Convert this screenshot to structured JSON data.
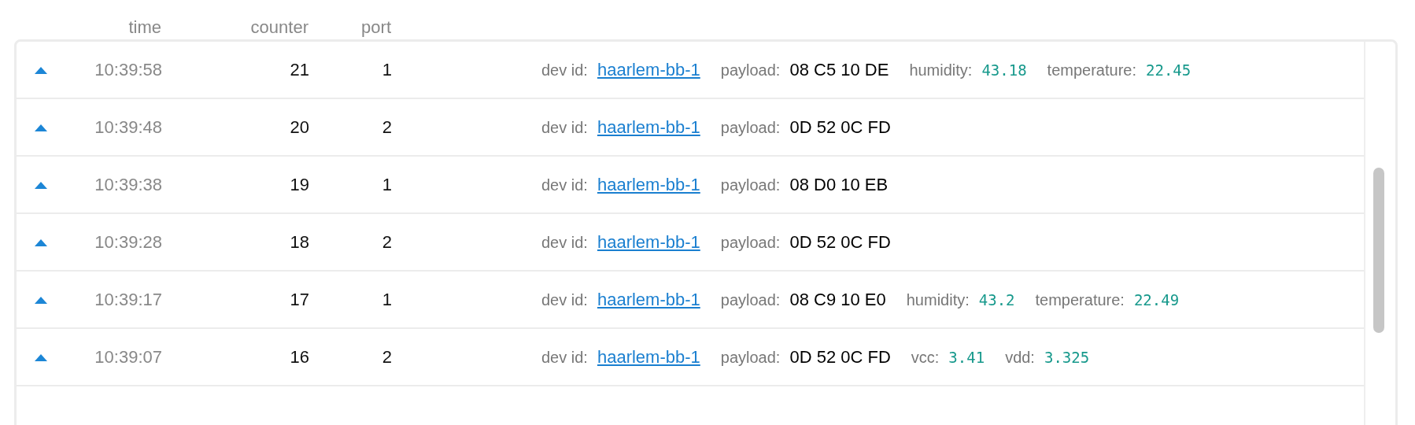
{
  "columns": [
    "time",
    "counter",
    "port"
  ],
  "rows": [
    {
      "time": "10:39:58",
      "counter": "21",
      "port": "1",
      "fields": [
        {
          "kind": "link",
          "label": "dev id:",
          "value": "haarlem-bb-1"
        },
        {
          "kind": "hex",
          "label": "payload:",
          "value": "08 C5 10 DE"
        },
        {
          "kind": "number",
          "label": "humidity:",
          "value": "43.18"
        },
        {
          "kind": "number",
          "label": "temperature:",
          "value": "22.45"
        }
      ]
    },
    {
      "time": "10:39:48",
      "counter": "20",
      "port": "2",
      "fields": [
        {
          "kind": "link",
          "label": "dev id:",
          "value": "haarlem-bb-1"
        },
        {
          "kind": "hex",
          "label": "payload:",
          "value": "0D 52 0C FD"
        }
      ]
    },
    {
      "time": "10:39:38",
      "counter": "19",
      "port": "1",
      "fields": [
        {
          "kind": "link",
          "label": "dev id:",
          "value": "haarlem-bb-1"
        },
        {
          "kind": "hex",
          "label": "payload:",
          "value": "08 D0 10 EB"
        }
      ]
    },
    {
      "time": "10:39:28",
      "counter": "18",
      "port": "2",
      "fields": [
        {
          "kind": "link",
          "label": "dev id:",
          "value": "haarlem-bb-1"
        },
        {
          "kind": "hex",
          "label": "payload:",
          "value": "0D 52 0C FD"
        }
      ]
    },
    {
      "time": "10:39:17",
      "counter": "17",
      "port": "1",
      "fields": [
        {
          "kind": "link",
          "label": "dev id:",
          "value": "haarlem-bb-1"
        },
        {
          "kind": "hex",
          "label": "payload:",
          "value": "08 C9 10 E0"
        },
        {
          "kind": "number",
          "label": "humidity:",
          "value": "43.2"
        },
        {
          "kind": "number",
          "label": "temperature:",
          "value": "22.49"
        }
      ]
    },
    {
      "time": "10:39:07",
      "counter": "16",
      "port": "2",
      "fields": [
        {
          "kind": "link",
          "label": "dev id:",
          "value": "haarlem-bb-1"
        },
        {
          "kind": "hex",
          "label": "payload:",
          "value": "0D 52 0C FD"
        },
        {
          "kind": "number",
          "label": "vcc:",
          "value": "3.41"
        },
        {
          "kind": "number",
          "label": "vdd:",
          "value": "3.325"
        }
      ]
    }
  ]
}
